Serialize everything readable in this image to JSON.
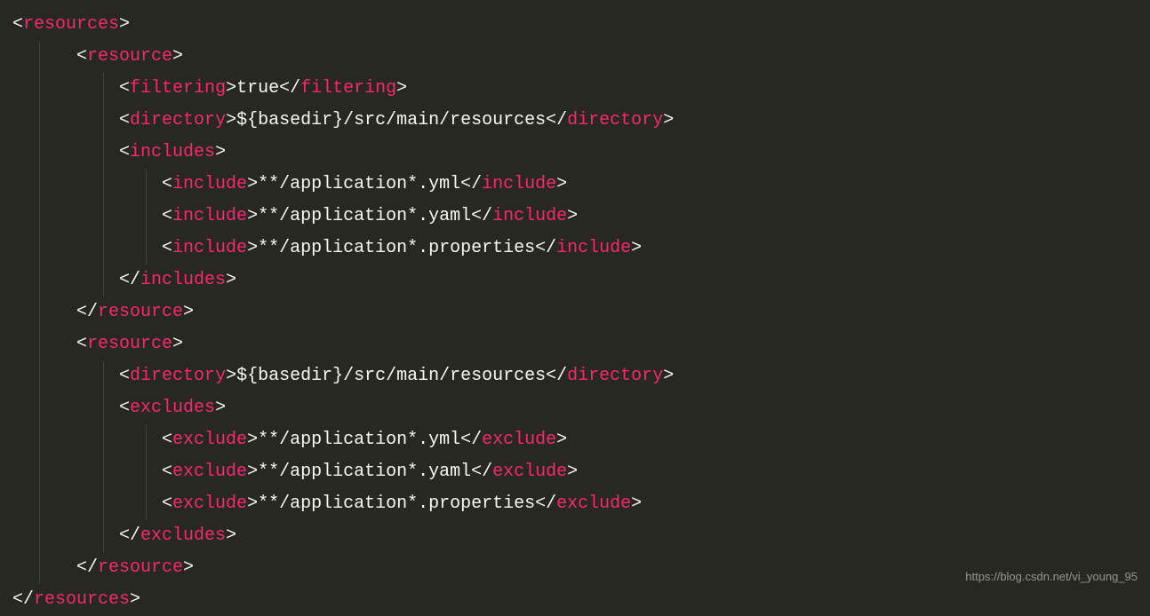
{
  "tags": {
    "resources": "resources",
    "resource": "resource",
    "filtering": "filtering",
    "directory": "directory",
    "includes": "includes",
    "include": "include",
    "excludes": "excludes",
    "exclude": "exclude"
  },
  "values": {
    "filtering": "true",
    "directory1": "${basedir}/src/main/resources",
    "directory2": "${basedir}/src/main/resources",
    "include1": "**/application*.yml",
    "include2": "**/application*.yaml",
    "include3": "**/application*.properties",
    "exclude1": "**/application*.yml",
    "exclude2": "**/application*.yaml",
    "exclude3": "**/application*.properties"
  },
  "watermark": "https://blog.csdn.net/vi_young_95"
}
